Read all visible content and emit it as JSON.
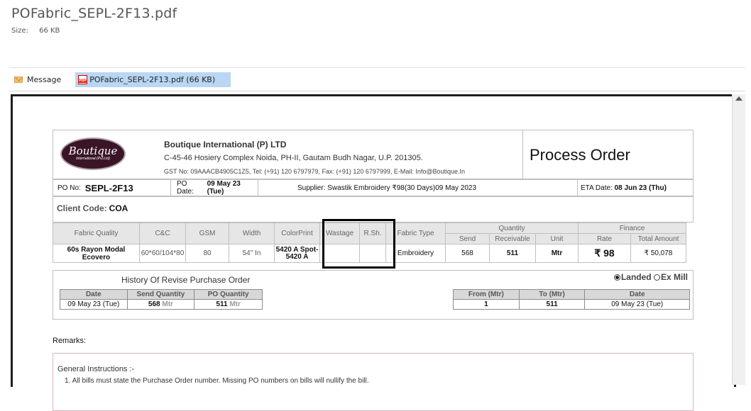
{
  "attachment": {
    "filename": "POFabric_SEPL-2F13.pdf",
    "size_label": "Size:",
    "size_value": "66 KB"
  },
  "tabs": {
    "message": "Message",
    "pdf": "POFabric_SEPL-2F13.pdf (66 KB)"
  },
  "doc": {
    "logo_line1": "Boutique",
    "logo_line2": "International (Pvt.Ltd)",
    "company": "Boutique International (P) LTD",
    "address": "C-45-46 Hosiery Complex Noida, PH-II, Gautam Budh Nagar, U.P. 201305.",
    "gst": "GST No: 09AAACB4905C1Z5, Tel: (+91) 120 6797979, Fax: (+91) 120 6797999, E-Mail: Info@Boutique.In",
    "title": "Process Order",
    "po_no_label": "PO No:",
    "po_no": "SEPL-2F13",
    "po_date_label": "PO Date:",
    "po_date": "09 May 23 (Tue)",
    "supplier": "Supplier: Swastik Embroidery ₹98(30 Days)09 May 2023",
    "eta_label": "ETA Date:",
    "eta": "08 Jun 23 (Thu)",
    "client_label": "Client Code:",
    "client_code": "COA",
    "table": {
      "headers": {
        "fabric_quality": "Fabric Quality",
        "cc": "C&C",
        "gsm": "GSM",
        "width": "Width",
        "colorprint": "ColorPrint",
        "wastage": "Wastage",
        "rsh": "R.Sh.",
        "fabric_type": "Fabric Type",
        "quantity": "Quantity",
        "finance": "Finance",
        "send": "Send",
        "receivable": "Receivable",
        "unit": "Unit",
        "rate": "Rate",
        "total": "Total Amount"
      },
      "row": {
        "fabric_quality": "60s Rayon Modal Ecovero",
        "cc": "60*60/104*80",
        "gsm": "80",
        "width": "54\" In",
        "colorprint_1": "5420 A Spot-",
        "colorprint_2": "5420 A",
        "wastage": "",
        "rsh": "",
        "fabric_type": "Embroidery",
        "send": "568",
        "receivable": "511",
        "unit": "Mtr",
        "rate": "₹ 98",
        "total": "₹ 50,078"
      }
    },
    "history": {
      "title": "History Of Revise Purchase Order",
      "landed": "Landed",
      "ex_mill": "Ex Mill",
      "left_headers": [
        "Date",
        "Send Quantity",
        "PO Quantity"
      ],
      "left_row": {
        "date": "09 May 23 (Tue)",
        "send": "568",
        "po": "511",
        "unit": "Mtr"
      },
      "right_headers": [
        "From (Mtr)",
        "To (Mtr)",
        "Date"
      ],
      "right_row": {
        "from": "1",
        "to": "511",
        "date": "09 May 23 (Tue)"
      }
    },
    "remarks_label": "Remarks:",
    "general_instructions": "General Instructions :-",
    "gi_line1": "1. All bills must state the Purchase Order number. Missing PO numbers on bills will nullify the bill."
  }
}
